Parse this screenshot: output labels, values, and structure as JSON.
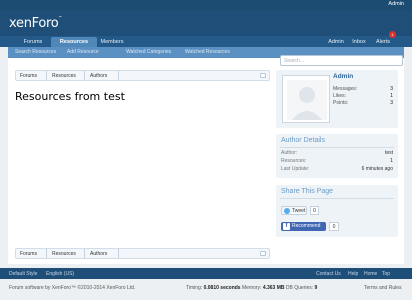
{
  "topbar": {
    "admin_label": "Admin"
  },
  "header": {
    "logo": "xenForo",
    "logo_mark": "™"
  },
  "nav": {
    "tabs": [
      {
        "label": "Forums"
      },
      {
        "label": "Resources"
      },
      {
        "label": "Members"
      }
    ],
    "right": [
      {
        "label": "Admin"
      },
      {
        "label": "Inbox"
      },
      {
        "label": "Alerts"
      }
    ],
    "alerts_count": "1"
  },
  "subnav": {
    "links": [
      "Search Resources",
      "Add Resource",
      "Watched Categories",
      "Watched Resources"
    ]
  },
  "breadcrumb": {
    "items": [
      "Forums",
      "Resources",
      "Authors"
    ]
  },
  "page_title": "Resources from test",
  "search": {
    "placeholder": "Search..."
  },
  "user": {
    "name": "Admin",
    "stats": [
      {
        "label": "Messages:",
        "value": "3"
      },
      {
        "label": "Likes:",
        "value": "1"
      },
      {
        "label": "Points:",
        "value": "3"
      }
    ]
  },
  "author_details": {
    "title": "Author Details",
    "rows": [
      {
        "label": "Author:",
        "value": "test"
      },
      {
        "label": "Resources:",
        "value": "1"
      },
      {
        "label": "Last Update:",
        "value": "6 minutes ago"
      }
    ]
  },
  "share": {
    "title": "Share This Page",
    "tweet_label": "Tweet",
    "tweet_count": "0",
    "recommend_label": "Recommend",
    "recommend_count": "0"
  },
  "footer": {
    "left": [
      "Default Style",
      "English (US)"
    ],
    "right": [
      "Contact Us",
      "Help",
      "Home",
      "Top"
    ],
    "copyright": "Forum software by XenForo™ ©2010-2014 XenForo Ltd.",
    "timing_label": "Timing:",
    "timing_value": "0.0810 seconds",
    "memory_label": "Memory:",
    "memory_value": "4.363 MB",
    "queries_label": "DB Queries:",
    "queries_value": "9",
    "terms": "Terms and Rules"
  }
}
